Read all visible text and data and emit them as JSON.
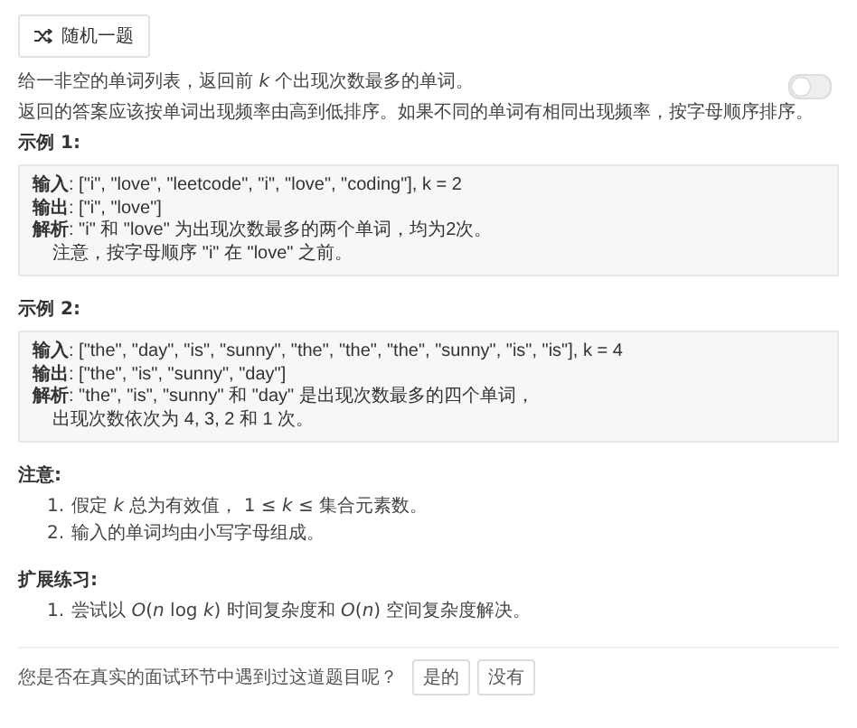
{
  "random_button": {
    "label": "随机一题"
  },
  "toggle": {
    "on": false
  },
  "description": [
    "给一非空的单词列表，返回前 *k* 个出现次数最多的单词。",
    "返回的答案应该按单词出现频率由高到低排序。如果不同的单词有相同出现频率，按字母顺序排序。"
  ],
  "examples": [
    {
      "title": "示例 1:",
      "lines": [
        "**输入**: [\"i\", \"love\", \"leetcode\", \"i\", \"love\", \"coding\"], k = 2",
        "**输出**: [\"i\", \"love\"]",
        "**解析**: \"i\" 和 \"love\" 为出现次数最多的两个单词，均为2次。",
        "    注意，按字母顺序 \"i\" 在 \"love\" 之前。"
      ]
    },
    {
      "title": "示例 2:",
      "lines": [
        "**输入**: [\"the\", \"day\", \"is\", \"sunny\", \"the\", \"the\", \"the\", \"sunny\", \"is\", \"is\"], k = 4",
        "**输出**: [\"the\", \"is\", \"sunny\", \"day\"]",
        "**解析**: \"the\", \"is\", \"sunny\" 和 \"day\" 是出现次数最多的四个单词，",
        "    出现次数依次为 4, 3, 2 和 1 次。"
      ]
    }
  ],
  "notes": {
    "title": "注意:",
    "items": [
      {
        "marker": "1.",
        "text": "假定 *k* 总为有效值， 1 ≤ *k* ≤ 集合元素数。"
      },
      {
        "marker": "2.",
        "text": "输入的单词均由小写字母组成。"
      }
    ]
  },
  "extension": {
    "title": "扩展练习:",
    "items": [
      {
        "marker": "1.",
        "text": "尝试以 *O*(*n* log *k*) 时间复杂度和 *O*(*n*) 空间复杂度解决。"
      }
    ]
  },
  "footer": {
    "question": "您是否在真实的面试环节中遇到过这道题目呢？",
    "buttons": [
      "是的",
      "没有"
    ]
  }
}
